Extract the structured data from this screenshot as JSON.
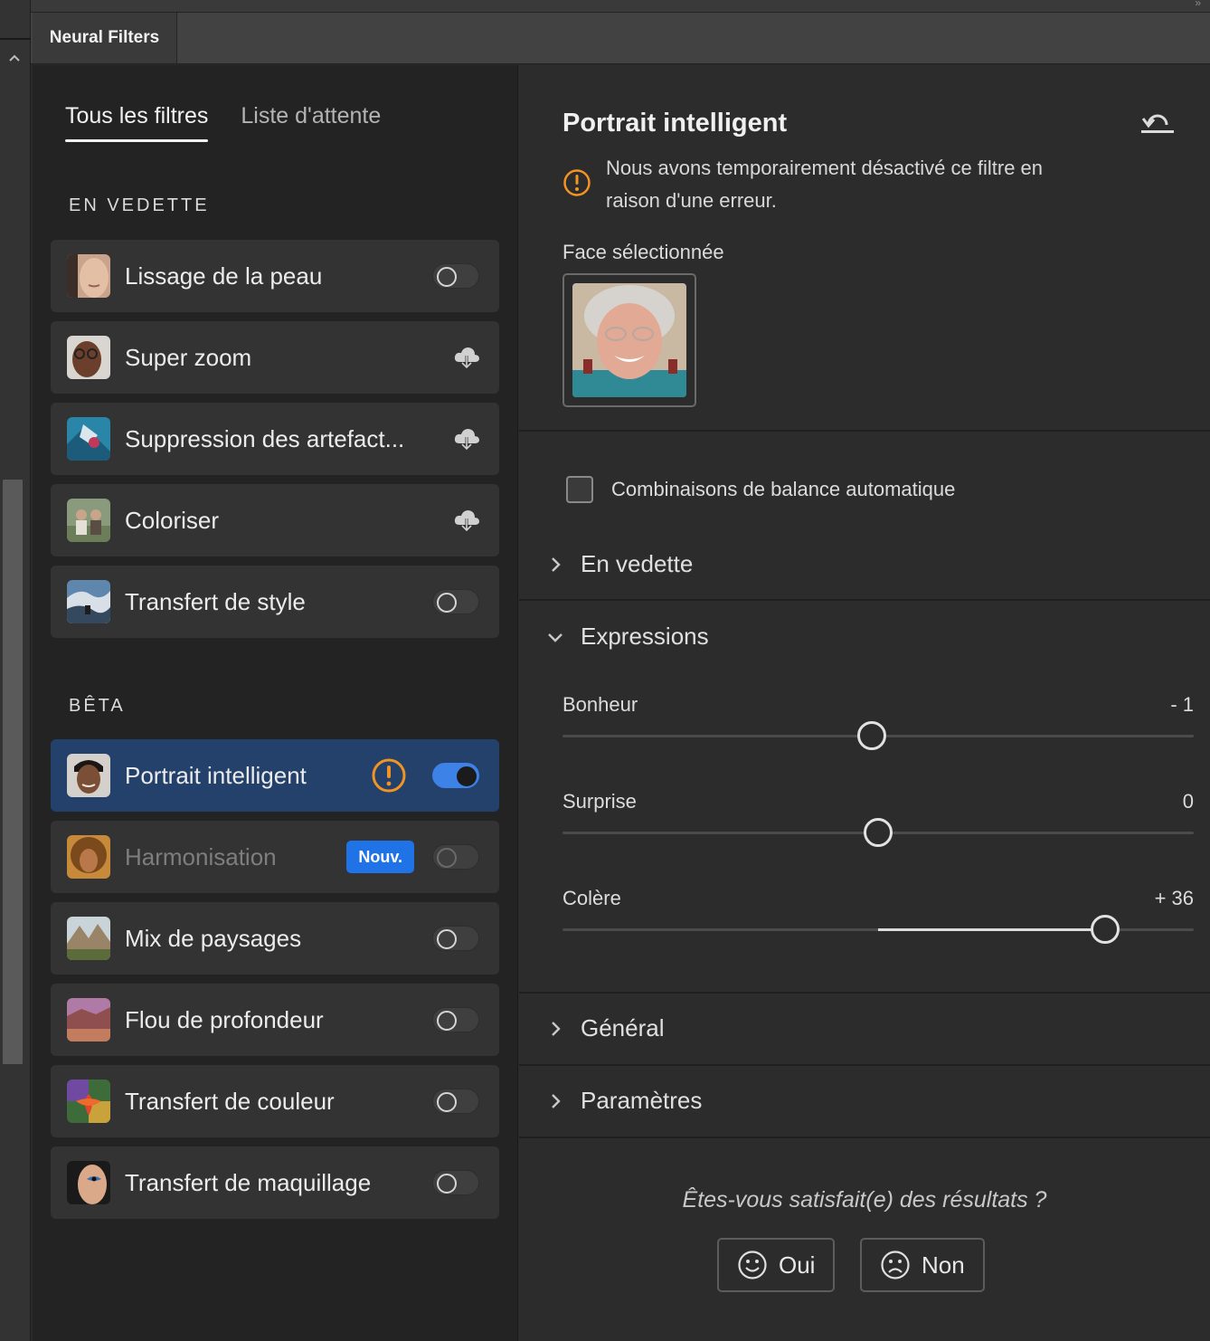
{
  "panel": {
    "tab_label": "Neural Filters"
  },
  "subtabs": [
    {
      "label": "Tous les filtres",
      "active": true
    },
    {
      "label": "Liste d'attente",
      "active": false
    }
  ],
  "sections": {
    "featured": "EN VEDETTE",
    "beta": "BÊTA"
  },
  "featured_filters": [
    {
      "label": "Lissage de la peau",
      "control": "toggle-off"
    },
    {
      "label": "Super zoom",
      "control": "cloud-download"
    },
    {
      "label": "Suppression des artefact...",
      "control": "cloud-download"
    },
    {
      "label": "Coloriser",
      "control": "cloud-download"
    },
    {
      "label": "Transfert de style",
      "control": "toggle-off"
    }
  ],
  "beta_filters": [
    {
      "label": "Portrait intelligent",
      "control": "toggle-on",
      "warning": true,
      "selected": true
    },
    {
      "label": "Harmonisation",
      "control": "toggle-off",
      "badge": "Nouv.",
      "disabled": true
    },
    {
      "label": "Mix de paysages",
      "control": "toggle-off"
    },
    {
      "label": "Flou de profondeur",
      "control": "toggle-off"
    },
    {
      "label": "Transfert de couleur",
      "control": "toggle-off"
    },
    {
      "label": "Transfert de maquillage",
      "control": "toggle-off"
    }
  ],
  "properties": {
    "title": "Portrait intelligent",
    "warning_text": "Nous avons temporairement désactivé ce filtre en raison d'une erreur.",
    "face_label": "Face sélectionnée",
    "auto_balance_label": "Combinaisons de balance automatique",
    "auto_balance_checked": false,
    "accordion_featured": "En vedette",
    "accordion_expressions": "Expressions",
    "accordion_general": "Général",
    "accordion_settings": "Paramètres",
    "sliders": [
      {
        "label": "Bonheur",
        "display": "- 1",
        "value": -1
      },
      {
        "label": "Surprise",
        "display": "0",
        "value": 0
      },
      {
        "label": "Colère",
        "display": "+ 36",
        "value": 36
      }
    ],
    "feedback_question": "Êtes-vous satisfait(e) des résultats ?",
    "feedback_yes": "Oui",
    "feedback_no": "Non"
  },
  "colors": {
    "selected_row": "#23416b",
    "toggle_on": "#3d82e6",
    "warning": "#f29423",
    "new_badge": "#1f73e6"
  }
}
